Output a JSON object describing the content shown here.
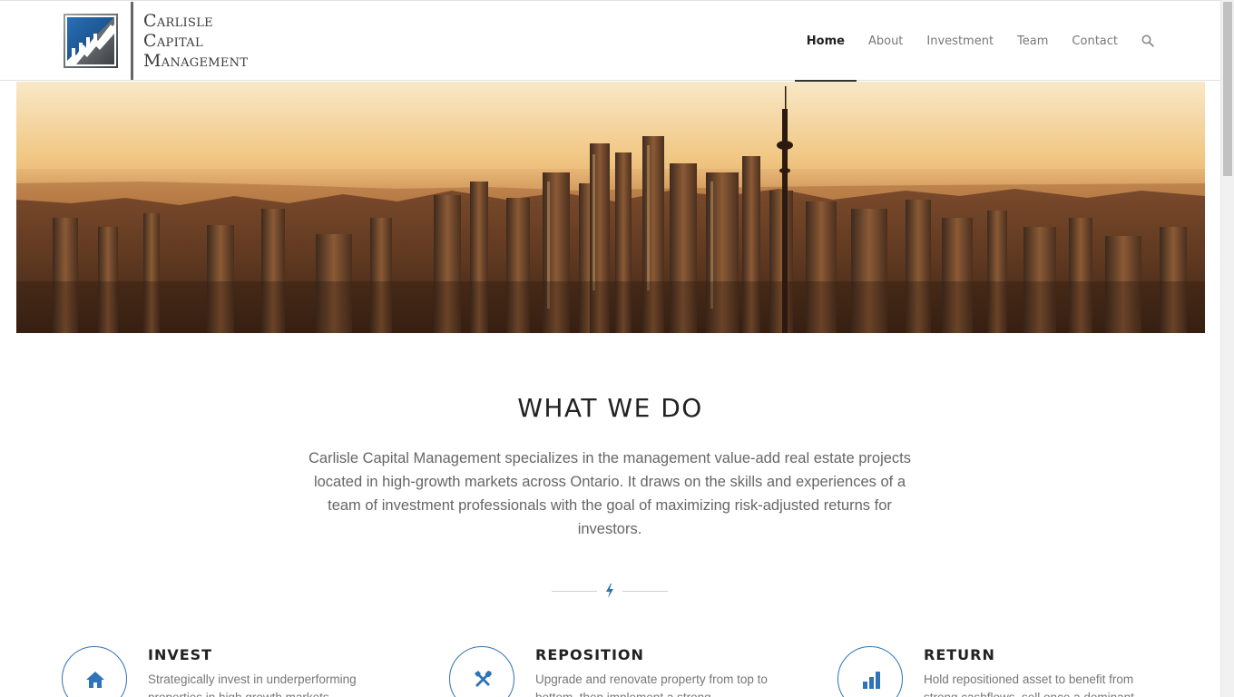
{
  "brand": {
    "name_lines": [
      "Carlisle",
      "Capital",
      "Management"
    ],
    "colors": {
      "accent": "#2f73b8",
      "logo_blue": "#1a5a9c",
      "text_dark": "#222222"
    }
  },
  "nav": {
    "items": [
      {
        "label": "Home",
        "active": true
      },
      {
        "label": "About",
        "active": false
      },
      {
        "label": "Investment",
        "active": false
      },
      {
        "label": "Team",
        "active": false
      },
      {
        "label": "Contact",
        "active": false
      }
    ],
    "search_icon": "search-icon"
  },
  "hero": {
    "icon": "city-skyline-image"
  },
  "what_we_do": {
    "title": "WHAT WE DO",
    "text": "Carlisle Capital Management specializes in the management value-add real estate projects located in high-growth markets across Ontario. It draws on the skills and experiences of a team of investment professionals with the goal of maximizing risk-adjusted returns for investors.",
    "separator_icon": "lightning-bolt-icon"
  },
  "features": [
    {
      "title": "INVEST",
      "text": "Strategically invest in underperforming properties in high growth markets",
      "icon": "home-icon"
    },
    {
      "title": "REPOSITION",
      "text": "Upgrade and renovate property from top to bottom, then implement a strong",
      "icon": "tools-icon"
    },
    {
      "title": "RETURN",
      "text": "Hold repositioned asset to benefit from strong cashflows, sell once a dominant",
      "icon": "bar-chart-icon"
    }
  ]
}
